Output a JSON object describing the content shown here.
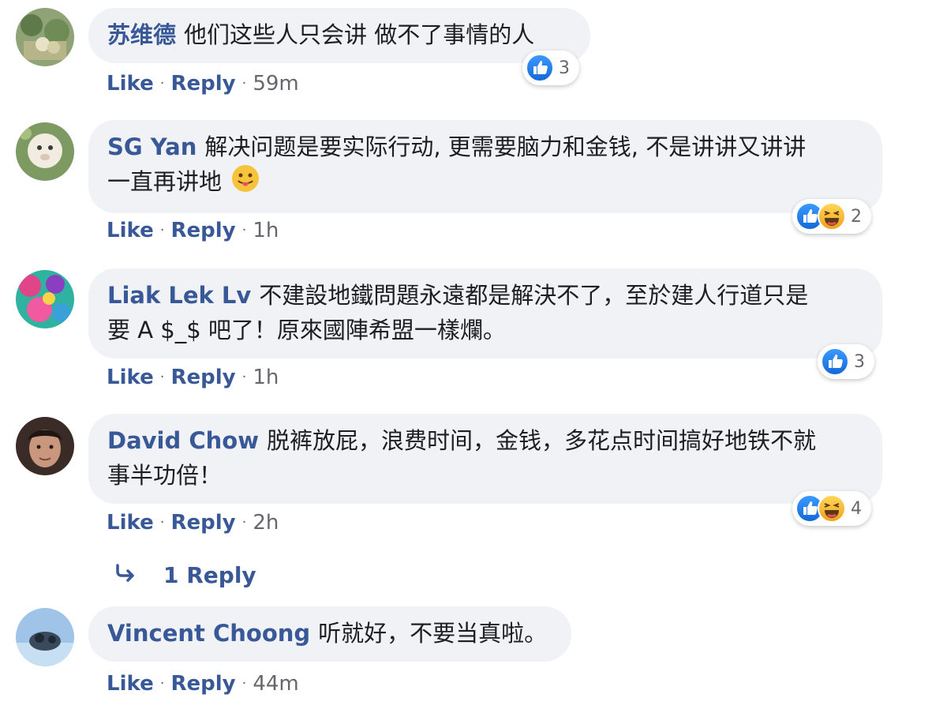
{
  "comments": [
    {
      "author": "苏维德",
      "text_lines": [
        "他们这些人只会讲 做不了事情的人"
      ],
      "reactions": [
        "like"
      ],
      "reaction_count": "3",
      "actions": {
        "like": "Like",
        "reply": "Reply",
        "time": "59m"
      }
    },
    {
      "author": "SG Yan",
      "text_lines": [
        "解决问题是要实际行动, 更需要脑力和金钱, 不是讲讲又讲讲",
        "一直再讲地"
      ],
      "emoji": "tongue-out-emoji",
      "reactions": [
        "like",
        "haha"
      ],
      "reaction_count": "2",
      "actions": {
        "like": "Like",
        "reply": "Reply",
        "time": "1h"
      }
    },
    {
      "author": "Liak Lek Lv",
      "text_lines": [
        "不建設地鐵問題永遠都是解決不了，至於建人行道只是",
        "要 A $_$ 吧了！原來國陣希盟一樣爛。"
      ],
      "reactions": [
        "like"
      ],
      "reaction_count": "3",
      "actions": {
        "like": "Like",
        "reply": "Reply",
        "time": "1h"
      }
    },
    {
      "author": "David Chow",
      "text_lines": [
        "脱裤放屁，浪费时间，金钱，多花点时间搞好地铁不就",
        "事半功倍！"
      ],
      "reactions": [
        "like",
        "haha"
      ],
      "reaction_count": "4",
      "actions": {
        "like": "Like",
        "reply": "Reply",
        "time": "2h"
      }
    },
    {
      "author": "Vincent Choong",
      "text_lines": [
        "听就好，不要当真啦。"
      ],
      "actions": {
        "like": "Like",
        "reply": "Reply",
        "time": "44m"
      }
    }
  ],
  "replies_link": {
    "label": "1 Reply",
    "icon": "reply-arrow-icon"
  },
  "colors": {
    "link": "#385898",
    "bubble": "#f0f2f5",
    "meta": "#65676b",
    "like_blue": "#1877f2",
    "haha_yellow": "#f7b125"
  }
}
